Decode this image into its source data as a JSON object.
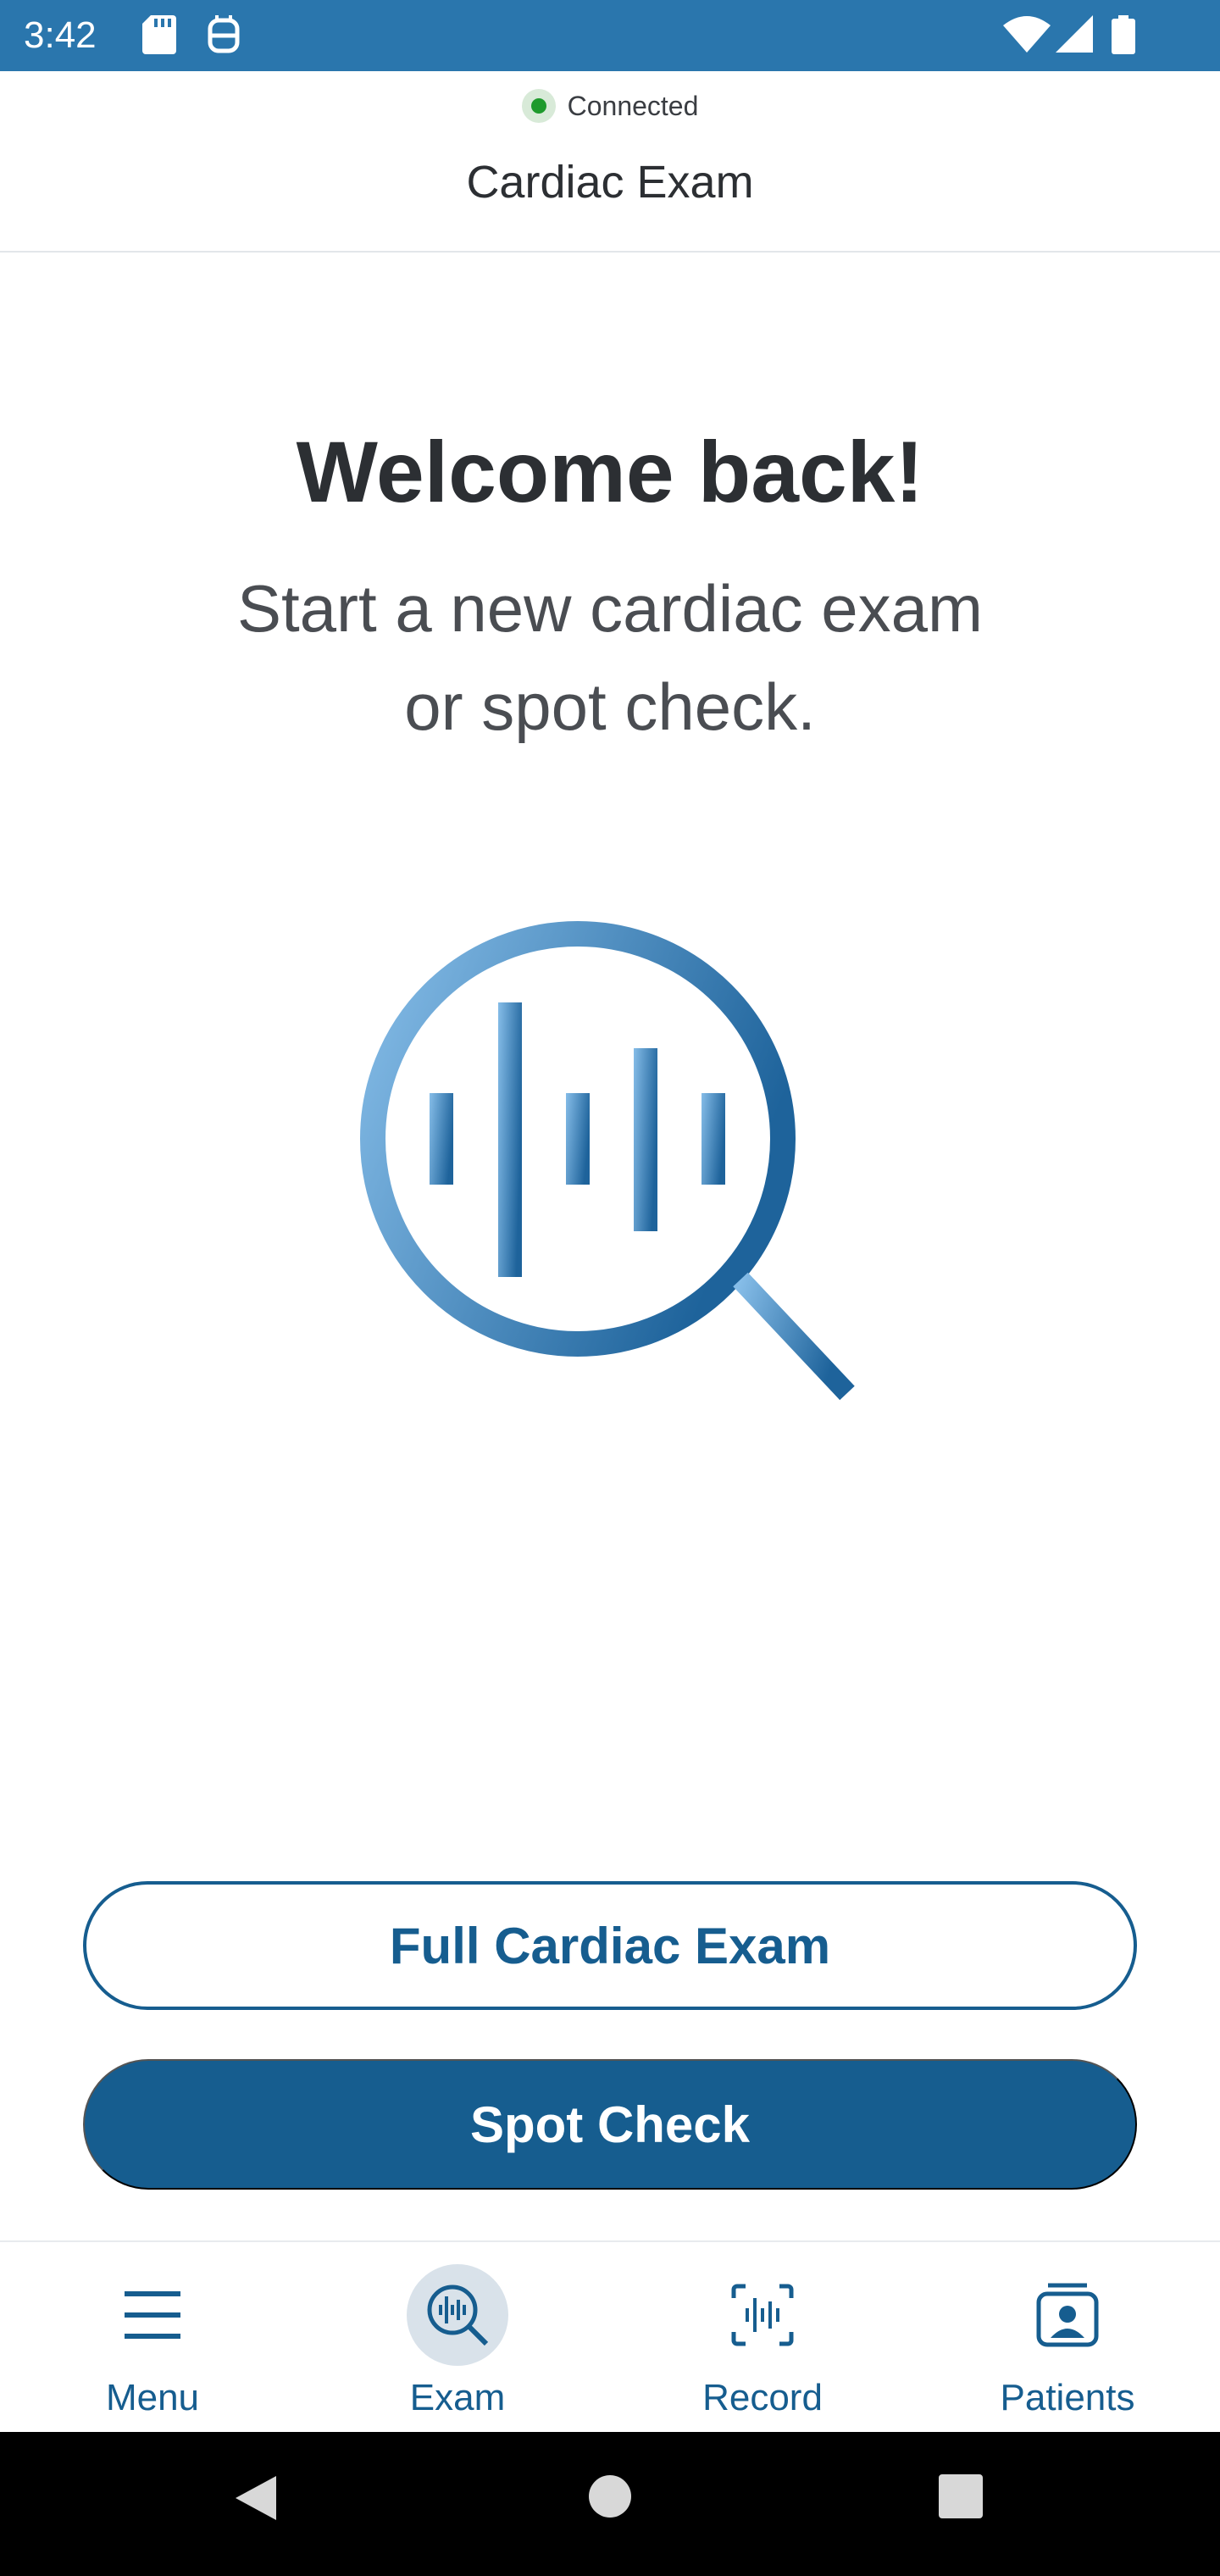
{
  "status_bar": {
    "time": "3:42",
    "icons_left": [
      "sd-card-icon",
      "notification-icon"
    ],
    "icons_right": [
      "wifi-icon",
      "signal-icon",
      "battery-icon"
    ],
    "color": "#2a76ad"
  },
  "header": {
    "connection_status": "Connected",
    "title": "Cardiac Exam"
  },
  "main": {
    "heading": "Welcome back!",
    "subtitle_line1": "Start a new cardiac exam",
    "subtitle_line2": "or spot check.",
    "hero_icon": "waveform-magnifier-icon"
  },
  "actions": {
    "primary_outline_label": "Full Cardiac Exam",
    "primary_filled_label": "Spot Check",
    "accent": "#165d8f"
  },
  "bottom_nav": {
    "items": [
      {
        "label": "Menu",
        "icon": "menu-icon",
        "active": false
      },
      {
        "label": "Exam",
        "icon": "exam-icon",
        "active": true
      },
      {
        "label": "Record",
        "icon": "record-icon",
        "active": false
      },
      {
        "label": "Patients",
        "icon": "patients-icon",
        "active": false
      }
    ]
  },
  "system_nav": {
    "icons": [
      "back-icon",
      "home-icon",
      "recents-icon"
    ]
  }
}
